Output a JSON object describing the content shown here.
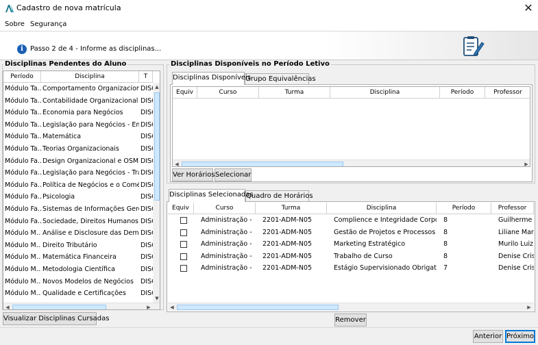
{
  "window": {
    "title": "Cadastro de nova matrícula"
  },
  "menu": [
    "Sobre",
    "Segurança"
  ],
  "banner": {
    "step_text": "Passo 2 de 4 - Informe as disciplinas..."
  },
  "pending": {
    "title": "Disciplinas Pendentes do Aluno",
    "columns": [
      "Período",
      "Disciplina",
      "T"
    ],
    "rows": [
      [
        "Módulo Ta...",
        "Comportamento Organizacional",
        "DISC"
      ],
      [
        "Módulo Ta...",
        "Contabilidade Organizacional",
        "DISC"
      ],
      [
        "Módulo Ta...",
        "Economia para Negócios",
        "DISC"
      ],
      [
        "Módulo Ta...",
        "Legislação para Negócios  - Em...",
        "DISC"
      ],
      [
        "Módulo Ta...",
        "Matemática",
        "DISC"
      ],
      [
        "Módulo Ta...",
        "Teorias Organizacionais",
        "DISC"
      ],
      [
        "Módulo Fa...",
        "Design Organizacional e OSM",
        "DISC"
      ],
      [
        "Módulo Fa...",
        "Legislação para Negócios - Trab...",
        "DISC"
      ],
      [
        "Módulo Fa...",
        "Política de Negócios e o Comér...",
        "DISC"
      ],
      [
        "Módulo Fa...",
        "Psicologia",
        "DISC"
      ],
      [
        "Módulo Fa...",
        "Sistemas de Informações Geren...",
        "DISC"
      ],
      [
        "Módulo Fa...",
        "Sociedade, Direitos Humanos e ...",
        "DISC"
      ],
      [
        "Módulo M...",
        "Análise e Disclosure das Dem...",
        "DISC"
      ],
      [
        "Módulo M...",
        "Direito Tributário",
        "DISC"
      ],
      [
        "Módulo M...",
        "Matemática Financeira",
        "DISC"
      ],
      [
        "Módulo M...",
        "Metodologia Científica",
        "DISC"
      ],
      [
        "Módulo M...",
        "Novos Modelos de Negócios",
        "DISC"
      ],
      [
        "Módulo M...",
        "Qualidade e Certificações",
        "DISC"
      ]
    ],
    "button": "Visualizar Disciplinas Cursadas"
  },
  "available": {
    "title": "Disciplinas Disponíveis no Período Letivo",
    "tabs": [
      "Disciplinas Disponíveis",
      "Grupo Equivalências"
    ],
    "columns": [
      "Equiv",
      "Curso",
      "Turma",
      "Disciplina",
      "Período",
      "Professor"
    ],
    "buttons": [
      "Ver Horários",
      "Selecionar"
    ]
  },
  "selected": {
    "tabs": [
      "Disciplinas Selecionadas",
      "Quadro de Horários"
    ],
    "columns": [
      "Equiv",
      "Curso",
      "Turma",
      "Disciplina",
      "Período",
      "Professor"
    ],
    "rows": [
      [
        "Administração - ...",
        "2201-ADM-N05",
        "Complience e Integridade Corporat...",
        "8",
        "Guilherme Ma"
      ],
      [
        "Administração - ...",
        "2201-ADM-N05",
        "Gestão de Projetos e Processos",
        "8",
        "Liliane Martins"
      ],
      [
        "Administração - ...",
        "2201-ADM-N05",
        "Marketing Estratégico",
        "8",
        "Murilo Luiz Fer"
      ],
      [
        "Administração - ...",
        "2201-ADM-N05",
        "Trabalho de Curso",
        "8",
        "Denise Cristina"
      ],
      [
        "Administração - ...",
        "2201-ADM-N05",
        "Estágio Supervisionado Obrigatório",
        "7",
        "Denise Cristina"
      ]
    ],
    "remove_button": "Remover"
  },
  "footer": {
    "back": "Anterior",
    "next": "Próximo"
  },
  "colors": {
    "selection": "#cde8ff",
    "accent": "#0078d7",
    "info": "#1a5fb4"
  }
}
